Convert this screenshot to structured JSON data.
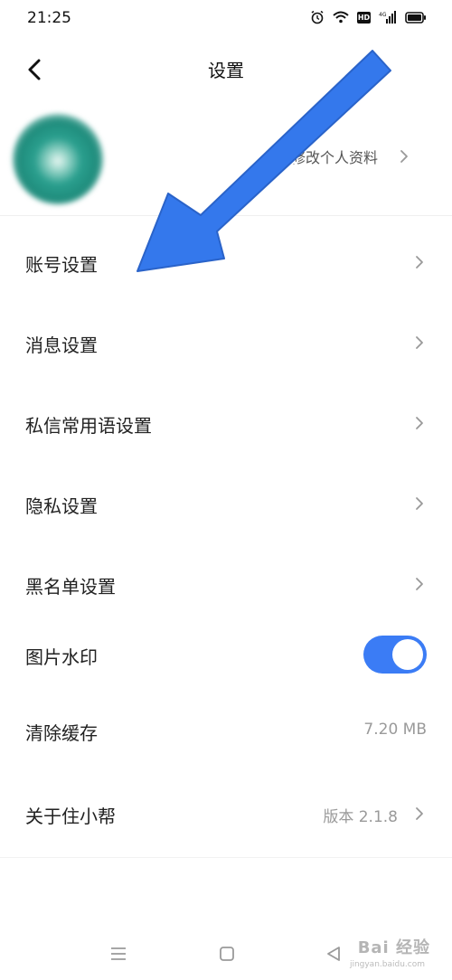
{
  "status_bar": {
    "time": "21:25",
    "icons": [
      "alarm-icon",
      "wifi-icon",
      "hd-icon",
      "signal-4g-icon",
      "battery-icon"
    ],
    "hd_label": "HD",
    "network_label": "4G"
  },
  "header": {
    "title": "设置",
    "back_icon": "back-chevron-icon"
  },
  "profile": {
    "edit_label": "修改个人资料"
  },
  "settings": {
    "account": {
      "label": "账号设置"
    },
    "message": {
      "label": "消息设置"
    },
    "dm_phrases": {
      "label": "私信常用语设置"
    },
    "privacy": {
      "label": "隐私设置"
    },
    "blacklist": {
      "label": "黑名单设置"
    },
    "watermark": {
      "label": "图片水印",
      "enabled": true
    },
    "clear_cache": {
      "label": "清除缓存",
      "value": "7.20 MB"
    },
    "about": {
      "label": "关于住小帮",
      "value": "版本 2.1.8"
    }
  },
  "colors": {
    "accent": "#3b7cf5",
    "arrow": "#3478ec",
    "value_text": "#9a9a9a"
  },
  "nav_bar": {
    "icons": [
      "menu-icon",
      "home-icon",
      "back-triangle-icon"
    ]
  },
  "watermark": {
    "text": "Bai 经验",
    "sub": "jingyan.baidu.com"
  }
}
